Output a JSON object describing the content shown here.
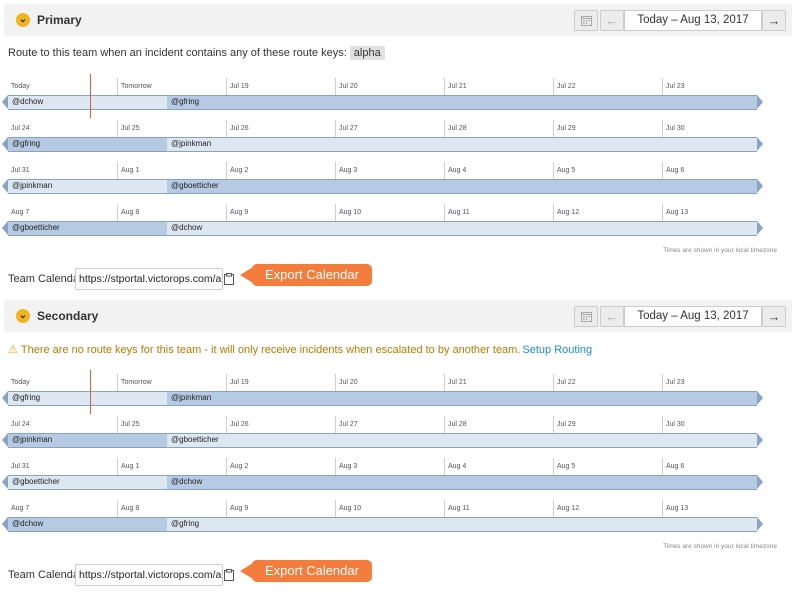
{
  "policies": [
    {
      "title": "Primary",
      "date_range": "Today – Aug 13, 2017",
      "route_text": "Route to this team when an incident contains any of these route keys:",
      "route_key": "alpha",
      "weeks": [
        {
          "days": [
            "Today",
            "Tomorrow",
            "Jul 19",
            "Jul 20",
            "Jul 21",
            "Jul 22",
            "Jul 23"
          ],
          "shifts": [
            "@dchow",
            "@gfring"
          ]
        },
        {
          "days": [
            "Jul 24",
            "Jul 25",
            "Jul 26",
            "Jul 27",
            "Jul 28",
            "Jul 29",
            "Jul 30"
          ],
          "shifts": [
            "@gfring",
            "@jpinkman"
          ]
        },
        {
          "days": [
            "Jul 31",
            "Aug 1",
            "Aug 2",
            "Aug 3",
            "Aug 4",
            "Aug 5",
            "Aug 6"
          ],
          "shifts": [
            "@jpinkman",
            "@gboetticher"
          ]
        },
        {
          "days": [
            "Aug 7",
            "Aug 8",
            "Aug 9",
            "Aug 10",
            "Aug 11",
            "Aug 12",
            "Aug 13"
          ],
          "shifts": [
            "@gboetticher",
            "@dchow"
          ]
        }
      ],
      "tz_note": "Times are shown in your local timezone",
      "calendar_label": "Team Calendar",
      "calendar_url": "https://stportal.victorops.com/api",
      "export_label": "Export Calendar"
    },
    {
      "title": "Secondary",
      "date_range": "Today – Aug 13, 2017",
      "warning_text": "There are no route keys for this team - it will only receive incidents when escalated to by another team.",
      "setup_link": "Setup Routing",
      "weeks": [
        {
          "days": [
            "Today",
            "Tomorrow",
            "Jul 19",
            "Jul 20",
            "Jul 21",
            "Jul 22",
            "Jul 23"
          ],
          "shifts": [
            "@gfring",
            "@jpinkman"
          ]
        },
        {
          "days": [
            "Jul 24",
            "Jul 25",
            "Jul 26",
            "Jul 27",
            "Jul 28",
            "Jul 29",
            "Jul 30"
          ],
          "shifts": [
            "@jpinkman",
            "@gboetticher"
          ]
        },
        {
          "days": [
            "Jul 31",
            "Aug 1",
            "Aug 2",
            "Aug 3",
            "Aug 4",
            "Aug 5",
            "Aug 6"
          ],
          "shifts": [
            "@gboetticher",
            "@dchow"
          ]
        },
        {
          "days": [
            "Aug 7",
            "Aug 8",
            "Aug 9",
            "Aug 10",
            "Aug 11",
            "Aug 12",
            "Aug 13"
          ],
          "shifts": [
            "@dchow",
            "@gfring"
          ]
        }
      ],
      "tz_note": "Times are shown in your local timezone",
      "calendar_label": "Team Calendar",
      "calendar_url": "https://stportal.victorops.com/api",
      "export_label": "Export Calendar"
    }
  ],
  "icons": {
    "chevron": "chevron-down-icon",
    "calendar": "calendar-icon",
    "prev": "arrow-left-icon",
    "next": "arrow-right-icon",
    "warning": "warning-icon",
    "copy": "clipboard-icon"
  },
  "colors": {
    "accent": "#f47c3c",
    "shift_light": "#dce7f2",
    "shift_dark": "#b6cbe3",
    "now_marker": "#e05a4a",
    "warning": "#b97a00",
    "link": "#1a8fc9"
  },
  "glyphs": {
    "chevron": "⌄",
    "prev": "←",
    "next": "→",
    "warning": "⚠"
  }
}
